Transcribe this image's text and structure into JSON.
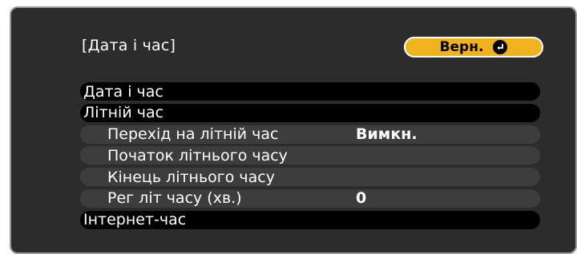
{
  "header": {
    "title": "[Дата і час]",
    "back_label": "Верн."
  },
  "menu": {
    "items": [
      {
        "label": "Дата і час",
        "value": ""
      },
      {
        "label": "Літній час",
        "value": ""
      },
      {
        "label": "Перехід на літній час",
        "value": "Вимкн."
      },
      {
        "label": "Початок літнього часу",
        "value": ""
      },
      {
        "label": "Кінець літнього часу",
        "value": ""
      },
      {
        "label": "Рег літ часу (хв.)",
        "value": "0"
      },
      {
        "label": "Інтернет-час",
        "value": ""
      }
    ]
  },
  "colors": {
    "panel": "#2c2c2c",
    "button": "#f0b21e",
    "top_row": "#000000",
    "sub_row": "#3d3d3d"
  },
  "icons": {
    "back": "enter-icon"
  }
}
